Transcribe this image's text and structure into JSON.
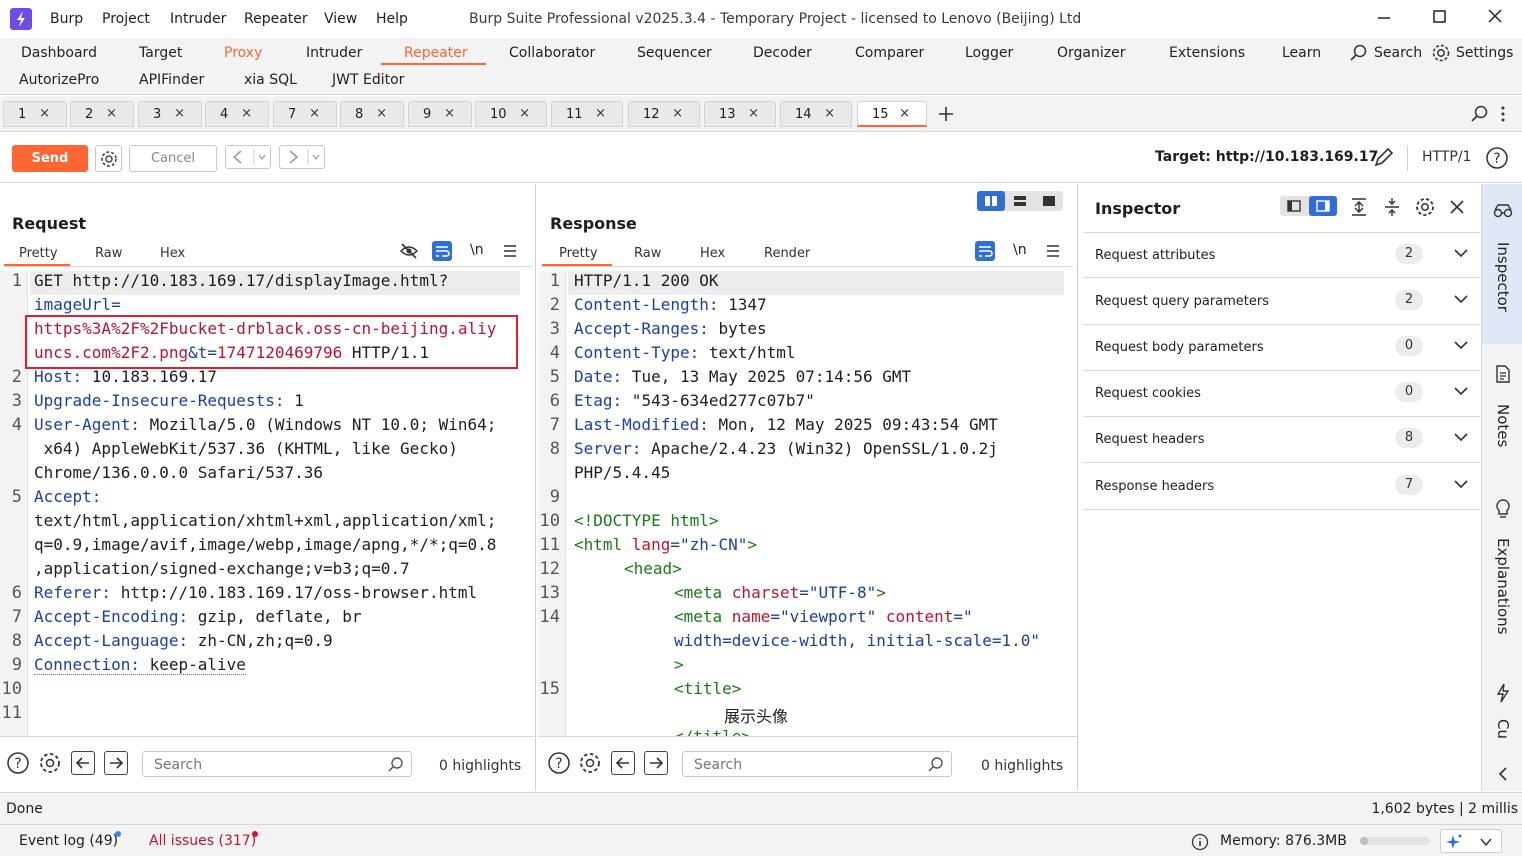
{
  "app": {
    "title": "Burp Suite Professional v2025.3.4 - Temporary Project - licensed to Lenovo (Beijing) Ltd",
    "menu": [
      "Burp",
      "Project",
      "Intruder",
      "Repeater",
      "View",
      "Help"
    ],
    "accent": "#ff6633"
  },
  "main_tabs": {
    "row1": [
      "Dashboard",
      "Target",
      "Proxy",
      "Intruder",
      "Repeater",
      "Collaborator",
      "Sequencer",
      "Decoder",
      "Comparer",
      "Logger",
      "Organizer",
      "Extensions",
      "Learn"
    ],
    "row2": [
      "AutorizePro",
      "APIFinder",
      "xia SQL",
      "JWT Editor"
    ],
    "search": "Search",
    "settings": "Settings"
  },
  "repeater_tabs": [
    "1",
    "2",
    "3",
    "4",
    "7",
    "8",
    "9",
    "10",
    "11",
    "12",
    "13",
    "14",
    "15"
  ],
  "toolbar": {
    "send": "Send",
    "cancel": "Cancel",
    "target": "Target: http://10.183.169.17",
    "protocol": "HTTP/1"
  },
  "request": {
    "title": "Request",
    "tabs": [
      "Pretty",
      "Raw",
      "Hex"
    ],
    "newline_toggle": "\\n",
    "lines": {
      "l1a": "GET http://10.183.169.17/displayImage.html?",
      "l1b": "imageUrl=",
      "l1c": "https%3A%2F%2Fbucket-drblack.oss-cn-beijing.aliy",
      "l1d_val": "uncs.com%2F2.png",
      "l1d_mid": "&t=",
      "l1d_t": "1747120469796",
      "l1d_end": " HTTP/1.1",
      "l2k": "Host:",
      "l2v": " 10.183.169.17",
      "l3k": "Upgrade-Insecure-Requests:",
      "l3v": " 1",
      "l4k": "User-Agent:",
      "l4v": " Mozilla/5.0 (Windows NT 10.0; Win64;",
      "l4b": " x64) AppleWebKit/537.36 (KHTML, like Gecko)",
      "l4c": "Chrome/136.0.0.0 Safari/537.36",
      "l5k": "Accept:",
      "l5a": "text/html,application/xhtml+xml,application/xml;",
      "l5b": "q=0.9,image/avif,image/webp,image/apng,*/*;q=0.8",
      "l5c": ",application/signed-exchange;v=b3;q=0.7",
      "l6k": "Referer:",
      "l6v": " http://10.183.169.17/oss-browser.html",
      "l7k": "Accept-Encoding:",
      "l7v": " gzip, deflate, br",
      "l8k": "Accept-Language:",
      "l8v": " zh-CN,zh;q=0.9",
      "l9k": "Connection:",
      "l9v": " keep-alive"
    },
    "line_numbers": [
      "1",
      "2",
      "3",
      "4",
      "5",
      "6",
      "7",
      "8",
      "9",
      "10",
      "11"
    ],
    "search_placeholder": "Search",
    "highlights": "0 highlights"
  },
  "response": {
    "title": "Response",
    "tabs": [
      "Pretty",
      "Raw",
      "Hex",
      "Render"
    ],
    "newline_toggle": "\\n",
    "lines": {
      "l1": "HTTP/1.1 200 OK",
      "l2k": "Content-Length:",
      "l2v": " 1347",
      "l3k": "Accept-Ranges:",
      "l3v": " bytes",
      "l4k": "Content-Type:",
      "l4v": " text/html",
      "l5k": "Date:",
      "l5v": " Tue, 13 May 2025 07:14:56 GMT",
      "l6k": "Etag:",
      "l6v": " \"543-634ed277c07b7\"",
      "l7k": "Last-Modified:",
      "l7v": " Mon, 12 May 2025 09:43:54 GMT",
      "l8k": "Server:",
      "l8v": " Apache/2.4.23 (Win32) OpenSSL/1.0.2j",
      "l8b": "PHP/5.4.45",
      "l10": "<!DOCTYPE html>",
      "l11a": "<html ",
      "l11b": "lang",
      "l11c": "=\"zh-CN\"",
      "l11d": ">",
      "l12": "<head>",
      "l13a": "<meta ",
      "l13b": "charset",
      "l13c": "=\"UTF-8\"",
      "l13d": ">",
      "l14a": "<meta ",
      "l14b": "name",
      "l14c": "=\"viewport\" ",
      "l14d": "content",
      "l14e": "=\"",
      "l14f": "width=device-width, initial-scale=1.0\"",
      "l14g": ">",
      "l15a": "<title>",
      "l15b": "展示头像",
      "l15c": "</title>"
    },
    "line_numbers": [
      "1",
      "2",
      "3",
      "4",
      "5",
      "6",
      "7",
      "8",
      "9",
      "10",
      "11",
      "12",
      "13",
      "14",
      "15"
    ],
    "search_placeholder": "Search",
    "highlights": "0 highlights"
  },
  "inspector": {
    "title": "Inspector",
    "rows": [
      {
        "label": "Request attributes",
        "count": "2"
      },
      {
        "label": "Request query parameters",
        "count": "2"
      },
      {
        "label": "Request body parameters",
        "count": "0"
      },
      {
        "label": "Request cookies",
        "count": "0"
      },
      {
        "label": "Request headers",
        "count": "8"
      },
      {
        "label": "Response headers",
        "count": "7"
      }
    ]
  },
  "side_rail": [
    "Inspector",
    "Notes",
    "Explanations",
    "Cu"
  ],
  "status": {
    "left": "Done",
    "right": "1,602 bytes | 2 millis"
  },
  "footer": {
    "event_log": "Event log (49)",
    "all_issues": "All issues (317)",
    "memory": "Memory: 876.3MB"
  }
}
